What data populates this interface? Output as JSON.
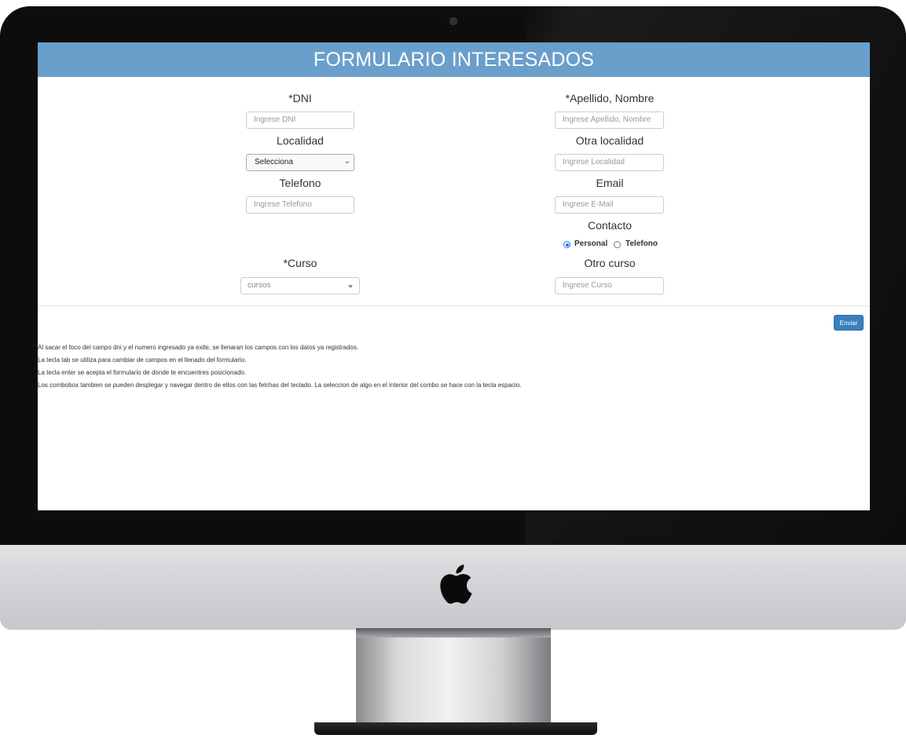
{
  "header": {
    "title": "FORMULARIO INTERESADOS"
  },
  "form": {
    "dni": {
      "label": "*DNI",
      "placeholder": "Ingrese DNI"
    },
    "apellido": {
      "label": "*Apellido, Nombre",
      "placeholder": "Ingrese Apellido, Nombre"
    },
    "localidad": {
      "label": "Localidad",
      "value": "Selecciona"
    },
    "otra_localidad": {
      "label": "Otra localidad",
      "placeholder": "Ingrese Localidad"
    },
    "telefono": {
      "label": "Telefono",
      "placeholder": "Ingrese Telefono"
    },
    "email": {
      "label": "Email",
      "placeholder": "Ingrese E-Mail"
    },
    "contacto": {
      "label": "Contacto",
      "options": [
        {
          "label": "Personal",
          "checked": true
        },
        {
          "label": "Telefono",
          "checked": false
        }
      ]
    },
    "curso": {
      "label": "*Curso",
      "value": "cursos"
    },
    "otro_curso": {
      "label": "Otro curso",
      "placeholder": "Ingrese Curso"
    },
    "submit_label": "Enviar"
  },
  "notes": [
    "Al sacar el foco del campo dni y el numero ingresado ya exite, se llenaran los campos con los datos ya registrados.",
    "La tecla tab se utiliza para cambiar de campos en el llenado del formulario.",
    "La tecla enter se acepta el formulario de donde te encuentres posicionado.",
    "Los combobox tambien se pueden desplegar y navegar dentro de ellos con las felchas del teclado. La seleccion de algo en el interior del combo se hace con la tecla espacio."
  ],
  "colors": {
    "header": "#6a9fcb",
    "button": "#3a7fc0"
  },
  "icons": {
    "device_logo": "apple-logo-icon"
  }
}
